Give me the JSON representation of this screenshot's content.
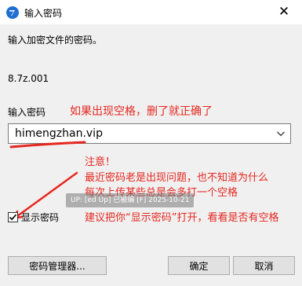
{
  "window": {
    "title": "输入密码",
    "close_glyph": "✕"
  },
  "prompt": "输入加密文件的密码。",
  "archive_name": "8.7z.001",
  "password": {
    "label": "输入密码",
    "value": "himengzhan.vip"
  },
  "annotations": {
    "hint_right": "如果出现空格，删了就正确了",
    "note_title": "注意！",
    "note_line1": "最近密码老是出现问题，也不知道为什么",
    "note_line2": "每次上传某些总是会多打一个空格",
    "note_line3": "建议把你“显示密码”打开，看看是否有空格",
    "watermark": "UP: [ed Up] 已被编 [F] 2025-10-21",
    "color": "#e5271f"
  },
  "show_password": {
    "label": "显示密码",
    "checked": true
  },
  "buttons": {
    "manager": "密码管理器...",
    "ok": "确定",
    "cancel": "取消"
  },
  "icons": {
    "app": "7zip-app-icon",
    "close": "close-icon",
    "dropdown": "chevron-down-icon",
    "check": "checkmark-icon"
  }
}
